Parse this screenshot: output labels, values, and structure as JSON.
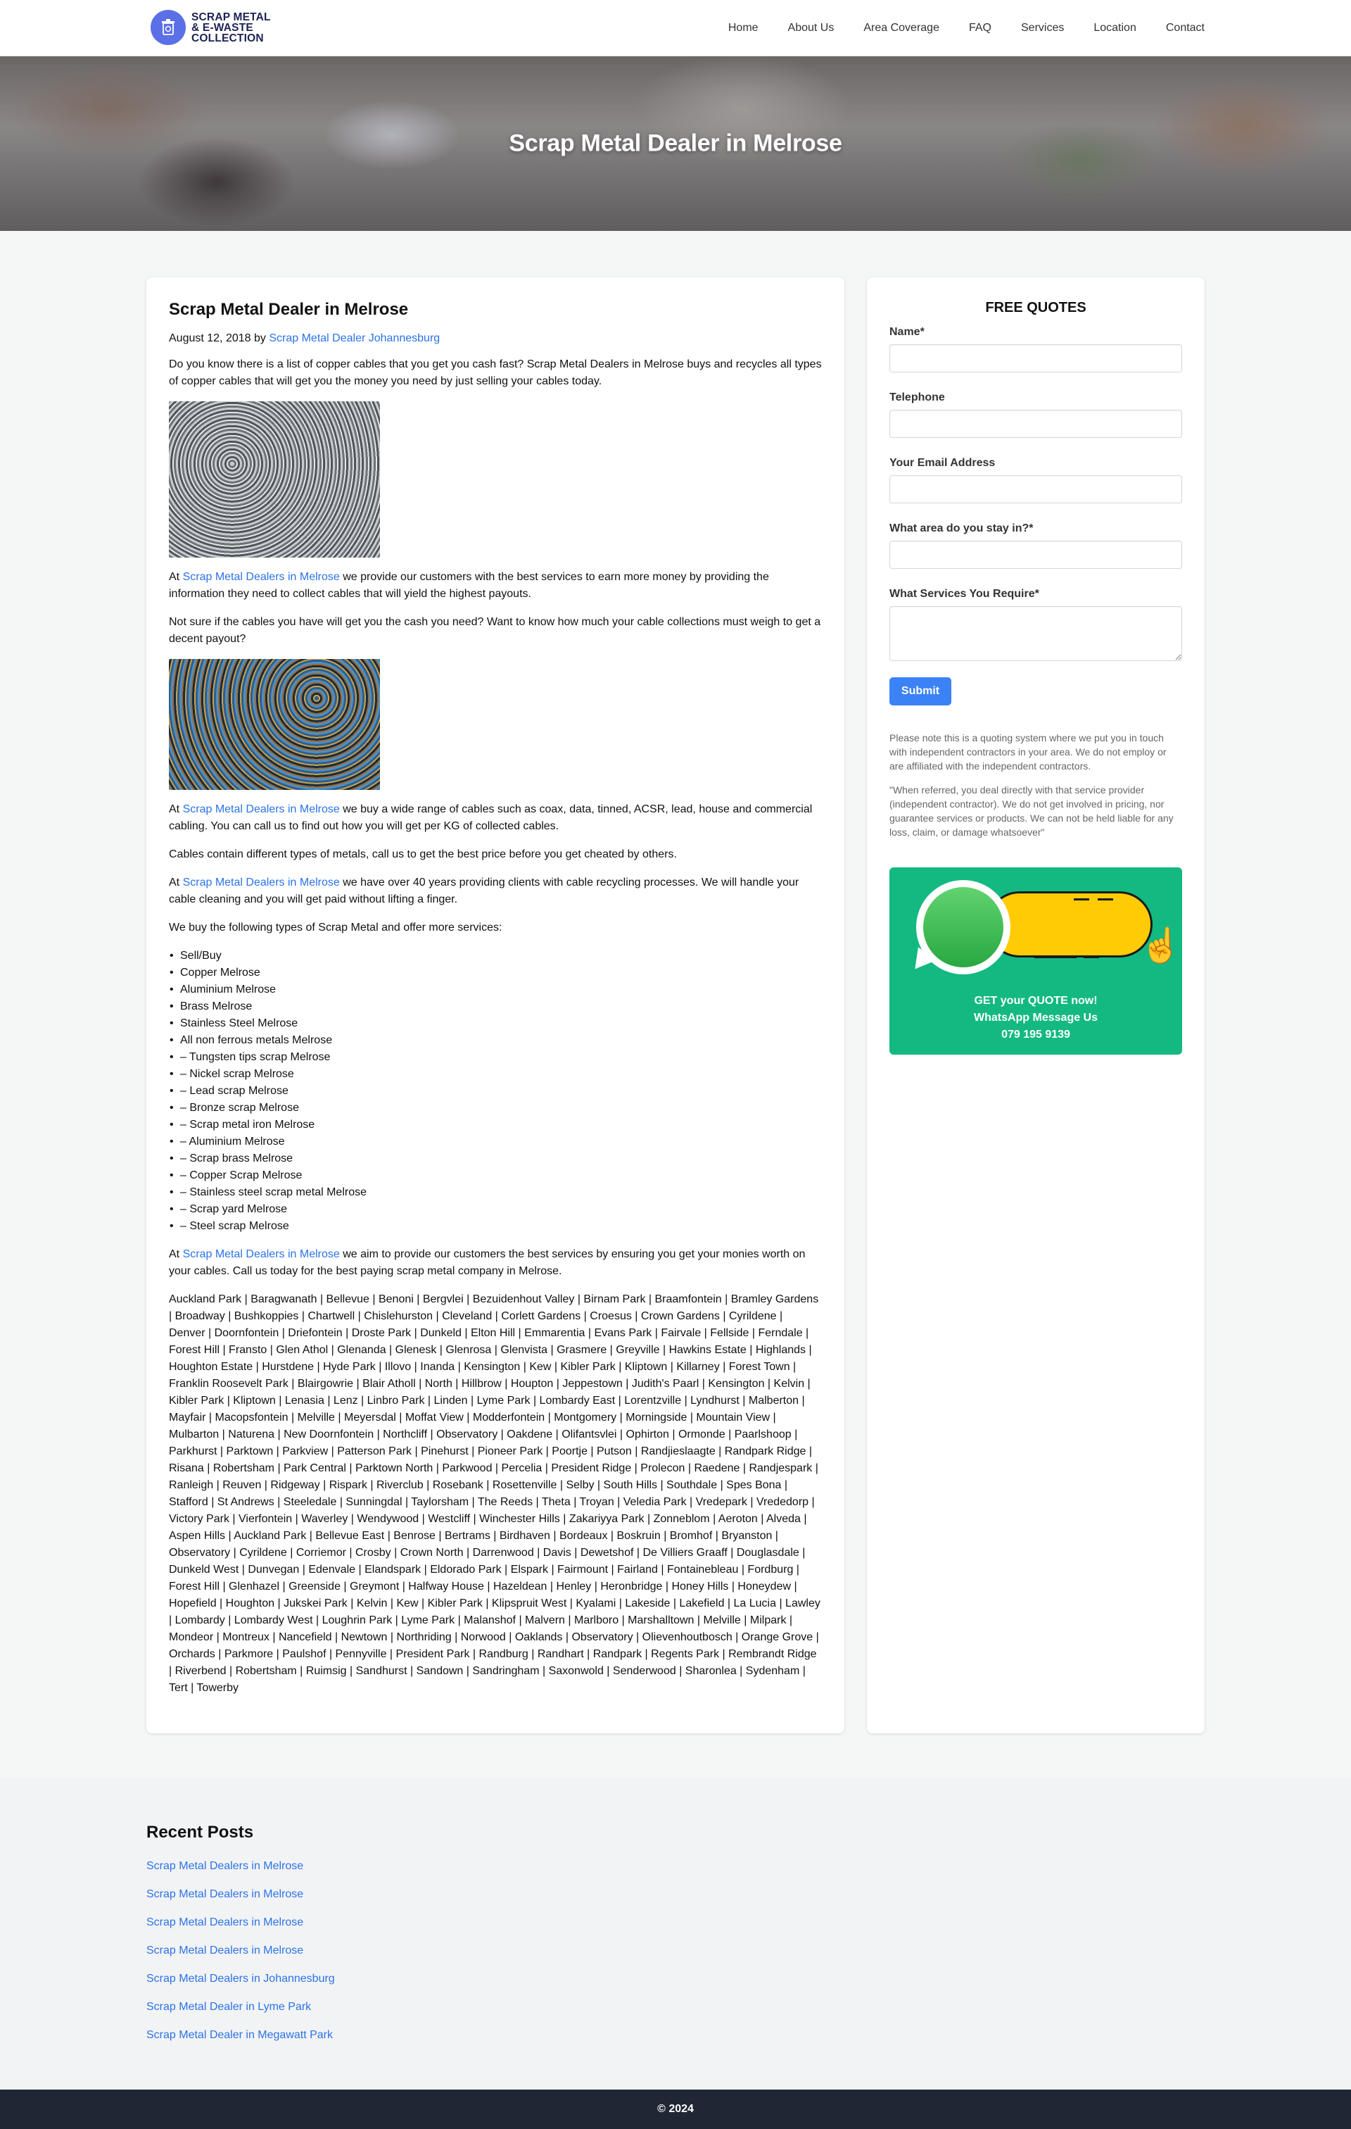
{
  "header": {
    "logo_line1": "SCRAP METAL",
    "logo_line2": "& E-WASTE",
    "logo_line3": "COLLECTION",
    "nav": [
      "Home",
      "About Us",
      "Area Coverage",
      "FAQ",
      "Services",
      "Location",
      "Contact"
    ]
  },
  "hero": {
    "title": "Scrap Metal Dealer in Melrose"
  },
  "article": {
    "title": "Scrap Metal Dealer in Melrose",
    "date": "August 12, 2018",
    "by": "by",
    "author": "Scrap Metal Dealer Johannesburg",
    "link_text": "Scrap Metal Dealers in Melrose",
    "p1": "Do you know there is a list of copper cables that you get you cash fast? Scrap Metal Dealers in Melrose buys and recycles all types of copper cables that will get you the money you need by just selling your cables today.",
    "p2_pre": "At",
    "p2_post": "we provide our customers with the best services to earn more money by providing the information they need to collect cables that will yield the highest payouts.",
    "p3": "Not sure if the cables you have will get you the cash you need? Want to know how much your cable collections must weigh to get a decent payout?",
    "p4_pre": "At",
    "p4_post": "we buy a wide range of cables such as coax, data, tinned, ACSR, lead, house and commercial cabling. You can call us to find out how you will get per KG of collected cables.",
    "p5": "Cables contain different types of metals, call us to get the best price before you get cheated by others.",
    "p6_pre": "At",
    "p6_post": "we have over 40 years providing clients with cable recycling processes. We will handle your cable cleaning and you will get paid without lifting a finger.",
    "p7": "We buy the following types of Scrap Metal and offer more services:",
    "list": [
      "Sell/Buy",
      "Copper Melrose",
      "Aluminium Melrose",
      "Brass Melrose",
      "Stainless Steel Melrose",
      "All non ferrous metals Melrose",
      "– Tungsten tips scrap Melrose",
      "– Nickel scrap Melrose",
      "– Lead scrap Melrose",
      "– Bronze scrap Melrose",
      "– Scrap metal iron Melrose",
      "– Aluminium Melrose",
      "– Scrap brass Melrose",
      "– Copper Scrap Melrose",
      "– Stainless steel scrap metal Melrose",
      "– Scrap yard Melrose",
      "– Steel scrap Melrose"
    ],
    "p8_pre": "At",
    "p8_post": "we aim to provide our customers the best services by ensuring you get your monies worth on your cables. Call us today for the best paying scrap metal company in Melrose.",
    "areas": "Auckland Park | Baragwanath | Bellevue | Benoni | Bergvlei | Bezuidenhout Valley | Birnam Park | Braamfontein | Bramley Gardens | Broadway | Bushkoppies | Chartwell | Chislehurston | Cleveland | Corlett Gardens | Croesus | Crown Gardens | Cyrildene | Denver | Doornfontein | Driefontein | Droste Park | Dunkeld | Elton Hill | Emmarentia | Evans Park | Fairvale | Fellside | Ferndale | Forest Hill | Fransto | Glen Athol | Glenanda | Glenesk | Glenrosa | Glenvista | Grasmere | Greyville | Hawkins Estate | Highlands | Houghton Estate | Hurstdene | Hyde Park | Illovo | Inanda | Kensington | Kew | Kibler Park | Kliptown | Killarney | Forest Town | Franklin Roosevelt Park | Blairgowrie | Blair Atholl | North | Hillbrow | Houpton | Jeppestown | Judith's Paarl | Kensington | Kelvin | Kibler Park | Kliptown | Lenasia | Lenz | Linbro Park | Linden | Lyme Park | Lombardy East | Lorentzville | Lyndhurst | Malberton | Mayfair | Macopsfontein | Melville | Meyersdal | Moffat View | Modderfontein | Montgomery | Morningside | Mountain View | Mulbarton | Naturena | New Doornfontein | Northcliff | Observatory | Oakdene | Olifantsvlei | Ophirton | Ormonde | Paarlshoop | Parkhurst | Parktown | Parkview | Patterson Park | Pinehurst | Pioneer Park | Poortje | Putson | Randjieslaagte | Randpark Ridge | Risana | Robertsham | Park Central | Parktown North | Parkwood | Percelia | President Ridge | Prolecon | Raedene | Randjespark | Ranleigh | Reuven | Ridgeway | Rispark | Riverclub | Rosebank | Rosettenville | Selby | South Hills | Southdale | Spes Bona | Stafford | St Andrews | Steeledale | Sunningdal | Taylorsham | The Reeds | Theta | Troyan | Veledia Park | Vredepark | Vrededorp | Victory Park | Vierfontein | Waverley | Wendywood | Westcliff | Winchester Hills | Zakariyya Park | Zonneblom | Aeroton | Alveda | Aspen Hills | Auckland Park | Bellevue East | Benrose | Bertrams | Birdhaven | Bordeaux | Boskruin | Bromhof | Bryanston | Observatory | Cyrildene | Corriemor | Crosby | Crown North | Darrenwood | Davis | Dewetshof | De Villiers Graaff | Douglasdale | Dunkeld West | Dunvegan | Edenvale | Elandspark | Eldorado Park | Elspark | Fairmount | Fairland | Fontainebleau | Fordburg | Forest Hill | Glenhazel | Greenside | Greymont | Halfway House | Hazeldean | Henley | Heronbridge | Honey Hills | Honeydew | Hopefield | Houghton | Jukskei Park | Kelvin | Kew | Kibler Park | Klipspruit West | Kyalami | Lakeside | Lakefield | La Lucia | Lawley | Lombardy | Lombardy West | Loughrin Park | Lyme Park | Malanshof | Malvern | Marlboro | Marshalltown | Melville | Milpark | Mondeor | Montreux | Nancefield | Newtown | Northriding | Norwood | Oaklands | Observatory | Olievenhoutbosch | Orange Grove | Orchards | Parkmore | Paulshof | Pennyville | President Park | Randburg | Randhart | Randpark | Regents Park | Rembrandt Ridge | Riverbend | Robertsham | Ruimsig | Sandhurst | Sandown | Sandringham | Saxonwold | Senderwood | Sharonlea | Sydenham | Tert | Towerby"
  },
  "quote_form": {
    "title": "FREE QUOTES",
    "name_label": "Name*",
    "phone_label": "Telephone",
    "email_label": "Your Email Address",
    "area_label": "What area do you stay in?*",
    "services_label": "What Services You Require*",
    "submit": "Submit",
    "note1": "Please note this is a quoting system where we put you in touch with independent contractors in your area. We do not employ or are affiliated with the independent contractors.",
    "note2": "\"When referred, you deal directly with that service provider (independent contractor). We do not get involved in pricing, nor guarantee services or products. We can not be held liable for any loss, claim, or damage whatsoever\""
  },
  "whatsapp": {
    "line1": "GET your QUOTE now!",
    "line2": "WhatsApp Message Us",
    "line3": "079 195 9139",
    "color": "#13b981"
  },
  "recent": {
    "title": "Recent Posts",
    "posts": [
      "Scrap Metal Dealers in Melrose",
      "Scrap Metal Dealers in Melrose",
      "Scrap Metal Dealers in Melrose",
      "Scrap Metal Dealers in Melrose",
      "Scrap Metal Dealers in Johannesburg",
      "Scrap Metal Dealer in Lyme Park",
      "Scrap Metal Dealer in Megawatt Park"
    ]
  },
  "footer": {
    "copyright": "© 2024"
  }
}
